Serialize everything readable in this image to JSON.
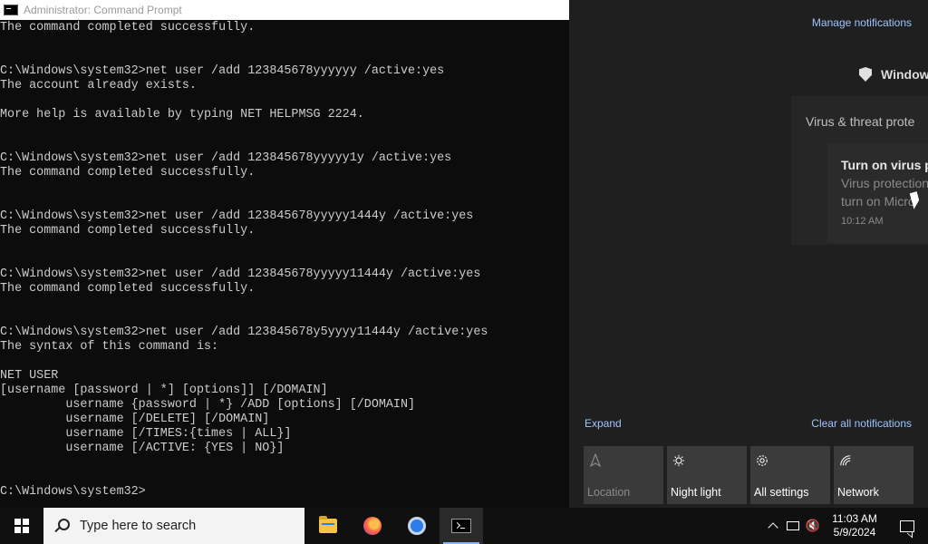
{
  "window": {
    "title": "Administrator: Command Prompt"
  },
  "console": {
    "lines": [
      "The command completed successfully.",
      "",
      "",
      "C:\\Windows\\system32>net user /add 123845678yyyyyy /active:yes",
      "The account already exists.",
      "",
      "More help is available by typing NET HELPMSG 2224.",
      "",
      "",
      "C:\\Windows\\system32>net user /add 123845678yyyyy1y /active:yes",
      "The command completed successfully.",
      "",
      "",
      "C:\\Windows\\system32>net user /add 123845678yyyyy1444y /active:yes",
      "The command completed successfully.",
      "",
      "",
      "C:\\Windows\\system32>net user /add 123845678yyyyy11444y /active:yes",
      "The command completed successfully.",
      "",
      "",
      "C:\\Windows\\system32>net user /add 123845678y5yyyy11444y /active:yes",
      "The syntax of this command is:",
      "",
      "NET USER",
      "[username [password | *] [options]] [/DOMAIN]",
      "         username {password | *} /ADD [options] [/DOMAIN]",
      "         username [/DELETE] [/DOMAIN]",
      "         username [/TIMES:{times | ALL}]",
      "         username [/ACTIVE: {YES | NO}]",
      "",
      "",
      "C:\\Windows\\system32>"
    ]
  },
  "action_center": {
    "manage_notifications": "Manage notifications",
    "group_title": "Window",
    "notification": {
      "app": "Virus & threat prote",
      "title": "Turn on virus p",
      "body_line1": "Virus protection",
      "body_line2": "turn on Micro",
      "time": "10:12 AM"
    },
    "expand": "Expand",
    "clear_all": "Clear all notifications",
    "quick_actions": [
      {
        "label": "Location",
        "icon": "location-icon",
        "enabled": false
      },
      {
        "label": "Night light",
        "icon": "night-light-icon",
        "enabled": true
      },
      {
        "label": "All settings",
        "icon": "gear-icon",
        "enabled": true
      },
      {
        "label": "Network",
        "icon": "network-icon",
        "enabled": true
      }
    ]
  },
  "taskbar": {
    "search_placeholder": "Type here to search",
    "apps": [
      "file-explorer-icon",
      "firefox-icon",
      "chrome-icon",
      "command-prompt-icon"
    ],
    "clock": {
      "time": "11:03 AM",
      "date": "5/9/2024"
    }
  }
}
